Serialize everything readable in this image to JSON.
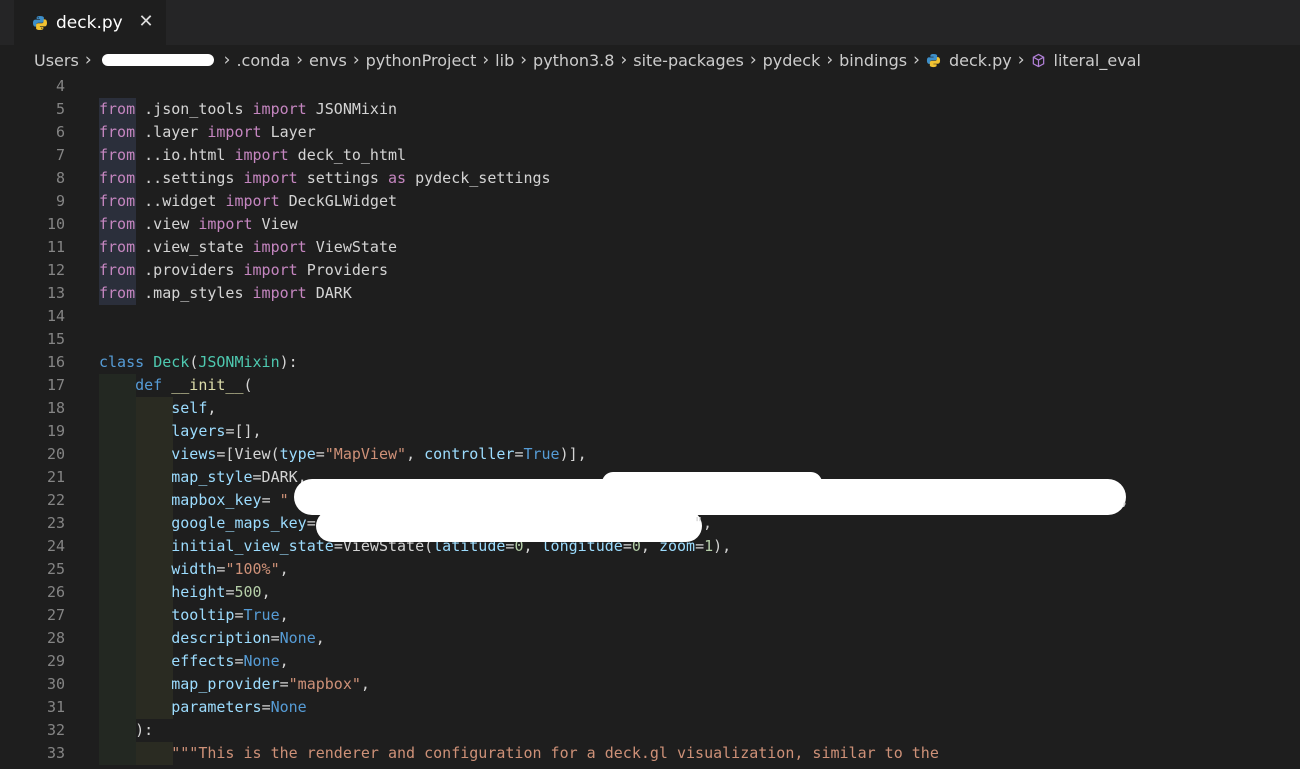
{
  "tab": {
    "label": "deck.py",
    "close": "✕",
    "icon": "python-icon"
  },
  "breadcrumb": [
    "Users",
    ".conda",
    "envs",
    "pythonProject",
    "lib",
    "python3.8",
    "site-packages",
    "pydeck",
    "bindings",
    "deck.py",
    "literal_eval"
  ],
  "lines": [
    {
      "n": "4",
      "tokens": []
    },
    {
      "n": "5",
      "tokens": [
        [
          "kw",
          "from"
        ],
        [
          "plain",
          " .json_tools "
        ],
        [
          "kw",
          "import"
        ],
        [
          "plain",
          " JSONMixin"
        ]
      ]
    },
    {
      "n": "6",
      "tokens": [
        [
          "kw",
          "from"
        ],
        [
          "plain",
          " .layer "
        ],
        [
          "kw",
          "import"
        ],
        [
          "plain",
          " Layer"
        ]
      ]
    },
    {
      "n": "7",
      "tokens": [
        [
          "kw",
          "from"
        ],
        [
          "plain",
          " ..io.html "
        ],
        [
          "kw",
          "import"
        ],
        [
          "plain",
          " deck_to_html"
        ]
      ]
    },
    {
      "n": "8",
      "tokens": [
        [
          "kw",
          "from"
        ],
        [
          "plain",
          " ..settings "
        ],
        [
          "kw",
          "import"
        ],
        [
          "plain",
          " settings "
        ],
        [
          "kw",
          "as"
        ],
        [
          "plain",
          " pydeck_settings"
        ]
      ]
    },
    {
      "n": "9",
      "tokens": [
        [
          "kw",
          "from"
        ],
        [
          "plain",
          " ..widget "
        ],
        [
          "kw",
          "import"
        ],
        [
          "plain",
          " DeckGLWidget"
        ]
      ]
    },
    {
      "n": "10",
      "tokens": [
        [
          "kw",
          "from"
        ],
        [
          "plain",
          " .view "
        ],
        [
          "kw",
          "import"
        ],
        [
          "plain",
          " View"
        ]
      ]
    },
    {
      "n": "11",
      "tokens": [
        [
          "kw",
          "from"
        ],
        [
          "plain",
          " .view_state "
        ],
        [
          "kw",
          "import"
        ],
        [
          "plain",
          " ViewState"
        ]
      ]
    },
    {
      "n": "12",
      "tokens": [
        [
          "kw",
          "from"
        ],
        [
          "plain",
          " .providers "
        ],
        [
          "kw",
          "import"
        ],
        [
          "plain",
          " Providers"
        ]
      ]
    },
    {
      "n": "13",
      "tokens": [
        [
          "kw",
          "from"
        ],
        [
          "plain",
          " .map_styles "
        ],
        [
          "kw",
          "import"
        ],
        [
          "plain",
          " DARK"
        ]
      ]
    },
    {
      "n": "14",
      "tokens": []
    },
    {
      "n": "15",
      "tokens": []
    },
    {
      "n": "16",
      "tokens": [
        [
          "def",
          "class"
        ],
        [
          "plain",
          " "
        ],
        [
          "cls",
          "Deck"
        ],
        [
          "plain",
          "("
        ],
        [
          "cls",
          "JSONMixin"
        ],
        [
          "plain",
          "):"
        ]
      ]
    },
    {
      "n": "17",
      "tokens": [
        [
          "plain",
          "    "
        ],
        [
          "def",
          "def"
        ],
        [
          "plain",
          " "
        ],
        [
          "fn",
          "__init__"
        ],
        [
          "plain",
          "("
        ]
      ]
    },
    {
      "n": "18",
      "tokens": [
        [
          "plain",
          "        "
        ],
        [
          "var",
          "self"
        ],
        [
          "plain",
          ","
        ]
      ]
    },
    {
      "n": "19",
      "tokens": [
        [
          "plain",
          "        "
        ],
        [
          "var",
          "layers"
        ],
        [
          "plain",
          "=[],"
        ]
      ]
    },
    {
      "n": "20",
      "tokens": [
        [
          "plain",
          "        "
        ],
        [
          "var",
          "views"
        ],
        [
          "plain",
          "=[View("
        ],
        [
          "var",
          "type"
        ],
        [
          "plain",
          "="
        ],
        [
          "str",
          "\"MapView\""
        ],
        [
          "plain",
          ", "
        ],
        [
          "var",
          "controller"
        ],
        [
          "plain",
          "="
        ],
        [
          "const",
          "True"
        ],
        [
          "plain",
          ")],"
        ]
      ]
    },
    {
      "n": "21",
      "tokens": [
        [
          "plain",
          "        "
        ],
        [
          "var",
          "map_style"
        ],
        [
          "plain",
          "=DARK,"
        ]
      ]
    },
    {
      "n": "22",
      "tokens": [
        [
          "plain",
          "        "
        ],
        [
          "var",
          "mapbox_key"
        ],
        [
          "plain",
          "= "
        ],
        [
          "str",
          "\""
        ]
      ]
    },
    {
      "n": "23",
      "tokens": [
        [
          "plain",
          "        "
        ],
        [
          "var",
          "google_maps_key"
        ],
        [
          "plain",
          "="
        ]
      ]
    },
    {
      "n": "24",
      "tokens": [
        [
          "plain",
          "        "
        ],
        [
          "var",
          "initial_view_state"
        ],
        [
          "plain",
          "=ViewState("
        ],
        [
          "var",
          "latitude"
        ],
        [
          "plain",
          "="
        ],
        [
          "num",
          "0"
        ],
        [
          "plain",
          ", "
        ],
        [
          "var",
          "longitude"
        ],
        [
          "plain",
          "="
        ],
        [
          "num",
          "0"
        ],
        [
          "plain",
          ", "
        ],
        [
          "var",
          "zoom"
        ],
        [
          "plain",
          "="
        ],
        [
          "num",
          "1"
        ],
        [
          "plain",
          "),"
        ]
      ]
    },
    {
      "n": "25",
      "tokens": [
        [
          "plain",
          "        "
        ],
        [
          "var",
          "width"
        ],
        [
          "plain",
          "="
        ],
        [
          "str",
          "\"100%\""
        ],
        [
          "plain",
          ","
        ]
      ]
    },
    {
      "n": "26",
      "tokens": [
        [
          "plain",
          "        "
        ],
        [
          "var",
          "height"
        ],
        [
          "plain",
          "="
        ],
        [
          "num",
          "500"
        ],
        [
          "plain",
          ","
        ]
      ]
    },
    {
      "n": "27",
      "tokens": [
        [
          "plain",
          "        "
        ],
        [
          "var",
          "tooltip"
        ],
        [
          "plain",
          "="
        ],
        [
          "const",
          "True"
        ],
        [
          "plain",
          ","
        ]
      ]
    },
    {
      "n": "28",
      "tokens": [
        [
          "plain",
          "        "
        ],
        [
          "var",
          "description"
        ],
        [
          "plain",
          "="
        ],
        [
          "const",
          "None"
        ],
        [
          "plain",
          ","
        ]
      ]
    },
    {
      "n": "29",
      "tokens": [
        [
          "plain",
          "        "
        ],
        [
          "var",
          "effects"
        ],
        [
          "plain",
          "="
        ],
        [
          "const",
          "None"
        ],
        [
          "plain",
          ","
        ]
      ]
    },
    {
      "n": "30",
      "tokens": [
        [
          "plain",
          "        "
        ],
        [
          "var",
          "map_provider"
        ],
        [
          "plain",
          "="
        ],
        [
          "str",
          "\"mapbox\""
        ],
        [
          "plain",
          ","
        ]
      ]
    },
    {
      "n": "31",
      "tokens": [
        [
          "plain",
          "        "
        ],
        [
          "var",
          "parameters"
        ],
        [
          "plain",
          "="
        ],
        [
          "const",
          "None"
        ]
      ]
    },
    {
      "n": "32",
      "tokens": [
        [
          "plain",
          "    ):"
        ]
      ]
    },
    {
      "n": "33",
      "tokens": [
        [
          "plain",
          "        "
        ],
        [
          "str",
          "\"\"\"This is the renderer and configuration for a deck.gl visualization, similar to the"
        ]
      ]
    }
  ],
  "line22_tail": ",",
  "line23_tail": "\","
}
